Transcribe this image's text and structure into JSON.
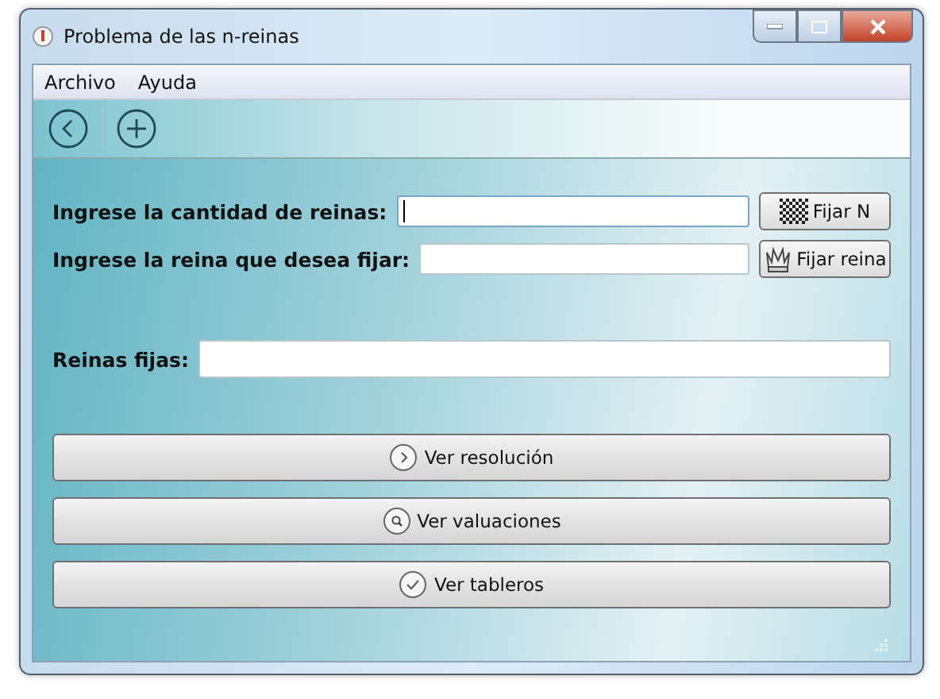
{
  "window": {
    "title": "Problema de las n-reinas"
  },
  "menu": [
    "Archivo",
    "Ayuda"
  ],
  "fields": [
    {
      "label": "Ingrese la cantidad de reinas:",
      "focused": true,
      "button": "Fijar N"
    },
    {
      "label": "Ingrese la reina que desea fijar:",
      "focused": false,
      "button": "Fijar reina"
    }
  ],
  "fixed": {
    "label": "Reinas fijas:"
  },
  "actions": [
    "Ver resolución",
    "Ver valuaciones",
    "Ver tableros"
  ]
}
